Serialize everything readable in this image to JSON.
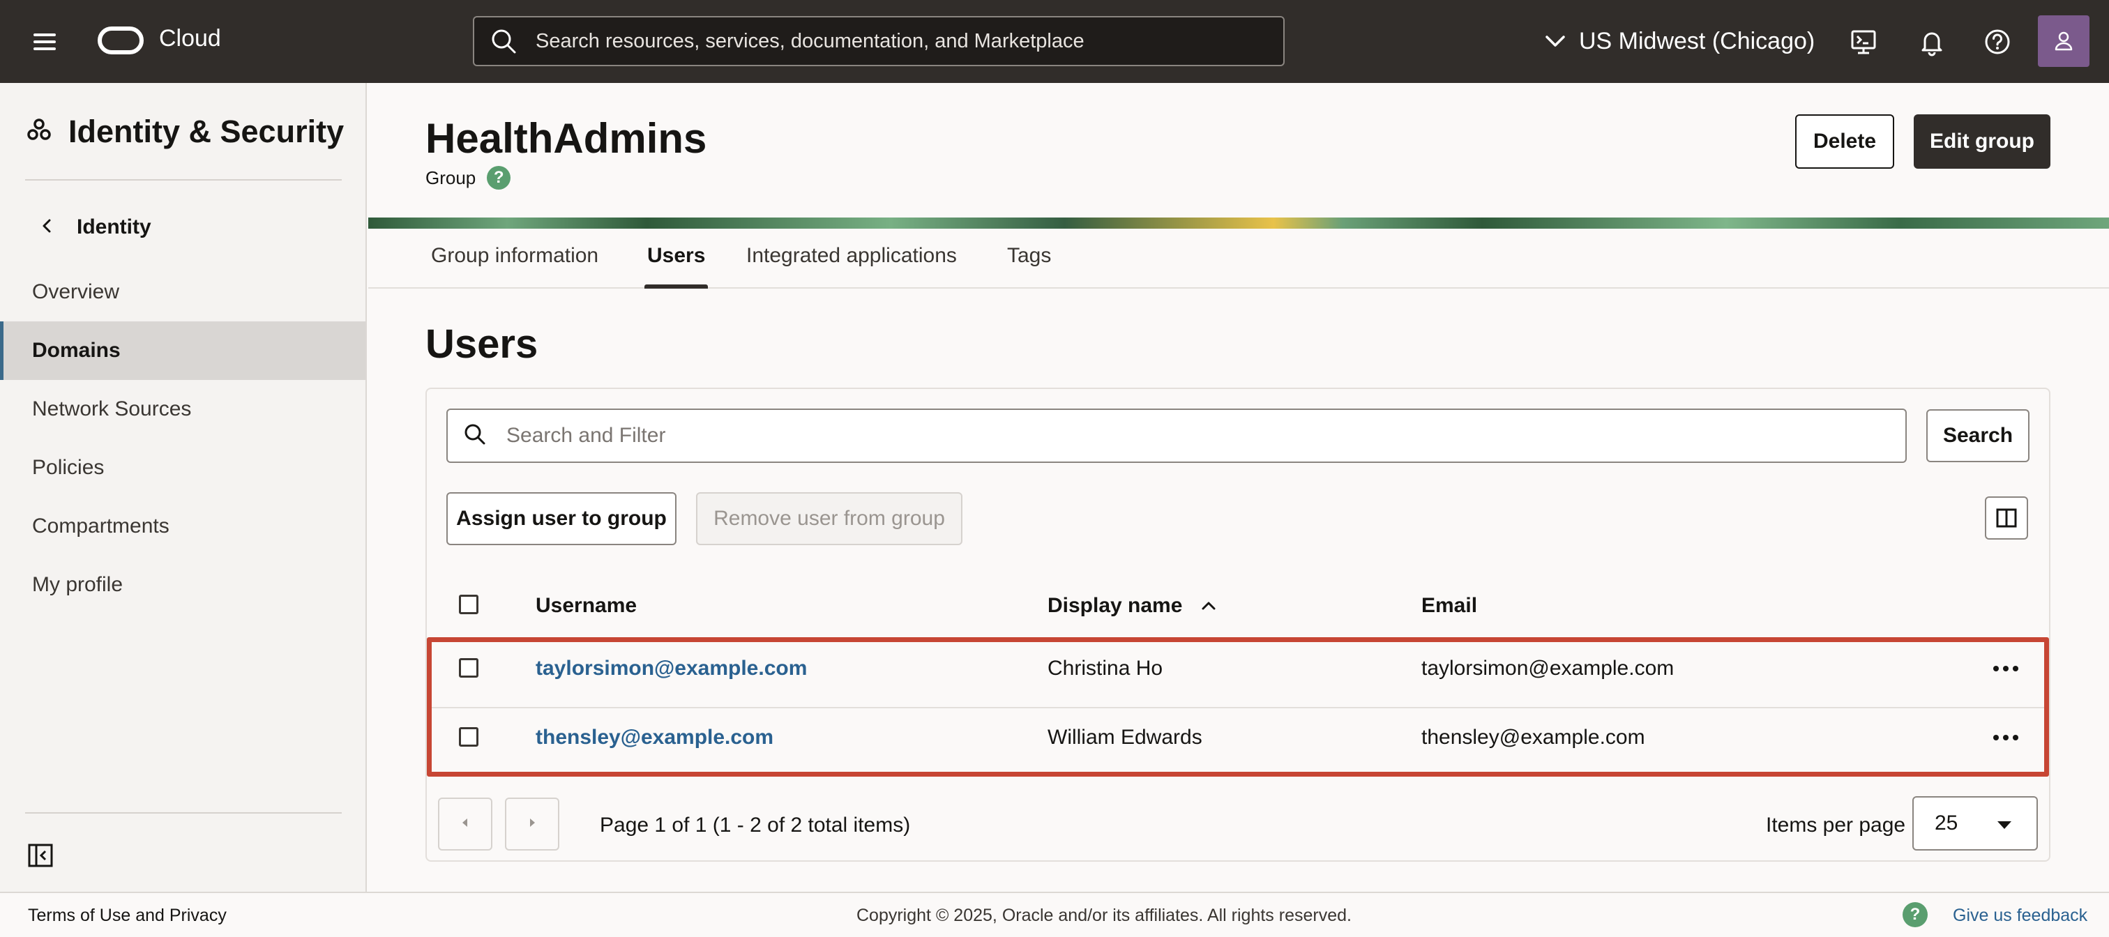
{
  "topbar": {
    "brand": "Cloud",
    "search_placeholder": "Search resources, services, documentation, and Marketplace",
    "region": "US Midwest (Chicago)",
    "icons": [
      "menu-icon",
      "cloud-shell-icon",
      "bell-icon",
      "help-icon",
      "profile-icon"
    ]
  },
  "sidebar": {
    "title": "Identity & Security",
    "back_label": "Identity",
    "items": [
      {
        "label": "Overview",
        "active": false
      },
      {
        "label": "Domains",
        "active": true
      },
      {
        "label": "Network Sources",
        "active": false
      },
      {
        "label": "Policies",
        "active": false
      },
      {
        "label": "Compartments",
        "active": false
      },
      {
        "label": "My profile",
        "active": false
      }
    ]
  },
  "header": {
    "title": "HealthAdmins",
    "subtitle": "Group",
    "help": "?",
    "delete_label": "Delete",
    "edit_label": "Edit group"
  },
  "tabs": [
    {
      "label": "Group information",
      "active": false
    },
    {
      "label": "Users",
      "active": true
    },
    {
      "label": "Integrated applications",
      "active": false
    },
    {
      "label": "Tags",
      "active": false
    }
  ],
  "users_section": {
    "title": "Users",
    "filter_placeholder": "Search and Filter",
    "search_label": "Search",
    "assign_label": "Assign user to group",
    "remove_label": "Remove user from group",
    "columns": [
      "Username",
      "Display name",
      "Email"
    ],
    "sorted_column": "Display name",
    "rows": [
      {
        "username": "taylorsimon@example.com",
        "display_name": "Christina Ho",
        "email": "taylorsimon@example.com"
      },
      {
        "username": "thensley@example.com",
        "display_name": "William Edwards",
        "email": "thensley@example.com"
      }
    ],
    "pagination": "Page 1 of 1 (1 - 2 of 2 total items)",
    "items_per_page_label": "Items per page",
    "items_per_page_value": "25"
  },
  "footer": {
    "terms": "Terms of Use and Privacy",
    "copyright": "Copyright © 2025, Oracle and/or its affiliates. All rights reserved.",
    "feedback": "Give us feedback"
  },
  "colors": {
    "topbar_bg": "#312d2a",
    "link": "#2a6190",
    "highlight_border": "#c74634",
    "help_green": "#5a9e6f"
  }
}
